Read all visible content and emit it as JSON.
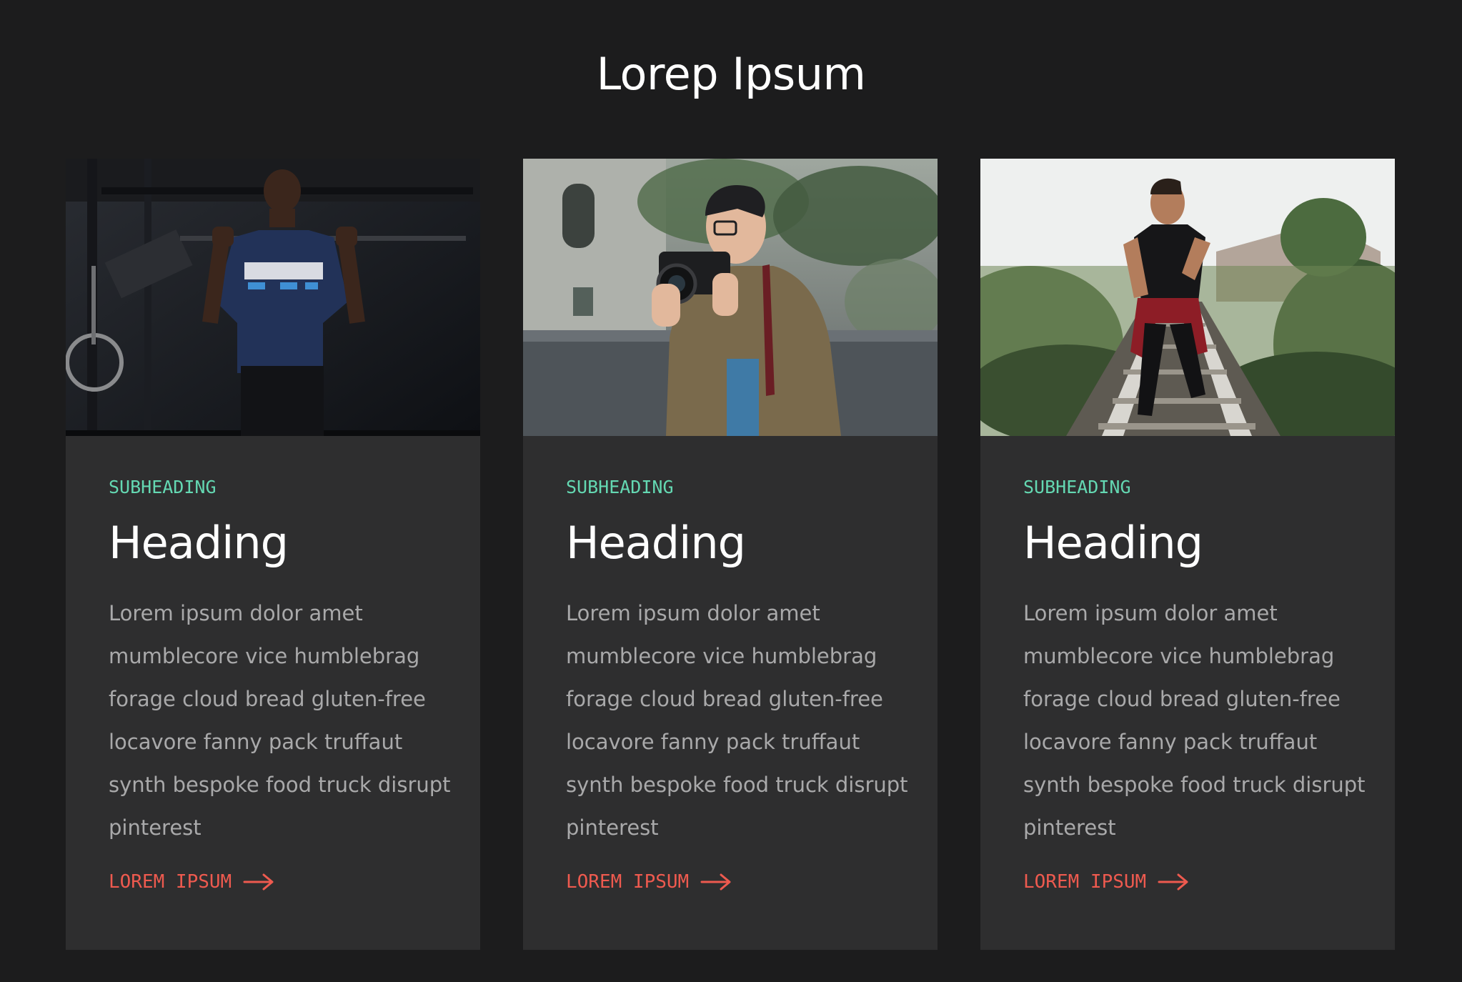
{
  "page": {
    "title": "Lorep Ipsum"
  },
  "colors": {
    "background": "#1c1c1d",
    "card_background": "#2e2e2f",
    "subheading": "#64d8b2",
    "heading": "#ffffff",
    "body_text": "#a9a9aa",
    "link": "#ee5a4f"
  },
  "cards": [
    {
      "photo_subject": "man doing pull-ups in a gym",
      "subheading": "SUBHEADING",
      "heading": "Heading",
      "body_lines": [
        "Lorem ipsum dolor amet",
        "mumblecore vice humblebrag",
        "forage cloud bread gluten-free",
        "locavore fanny pack truffaut",
        "synth bespoke food truck disrupt",
        "pinterest"
      ],
      "link_label": "LOREM IPSUM",
      "link_icon": "arrow-right-icon"
    },
    {
      "photo_subject": "photographer holding a camera on a street",
      "subheading": "SUBHEADING",
      "heading": "Heading",
      "body_lines": [
        "Lorem ipsum dolor amet",
        "mumblecore vice humblebrag",
        "forage cloud bread gluten-free",
        "locavore fanny pack truffaut",
        "synth bespoke food truck disrupt",
        "pinterest"
      ],
      "link_label": "LOREM IPSUM",
      "link_icon": "arrow-right-icon"
    },
    {
      "photo_subject": "man standing on railway tracks",
      "subheading": "SUBHEADING",
      "heading": "Heading",
      "body_lines": [
        "Lorem ipsum dolor amet",
        "mumblecore vice humblebrag",
        "forage cloud bread gluten-free",
        "locavore fanny pack truffaut",
        "synth bespoke food truck disrupt",
        "pinterest"
      ],
      "link_label": "LOREM IPSUM",
      "link_icon": "arrow-right-icon"
    }
  ]
}
